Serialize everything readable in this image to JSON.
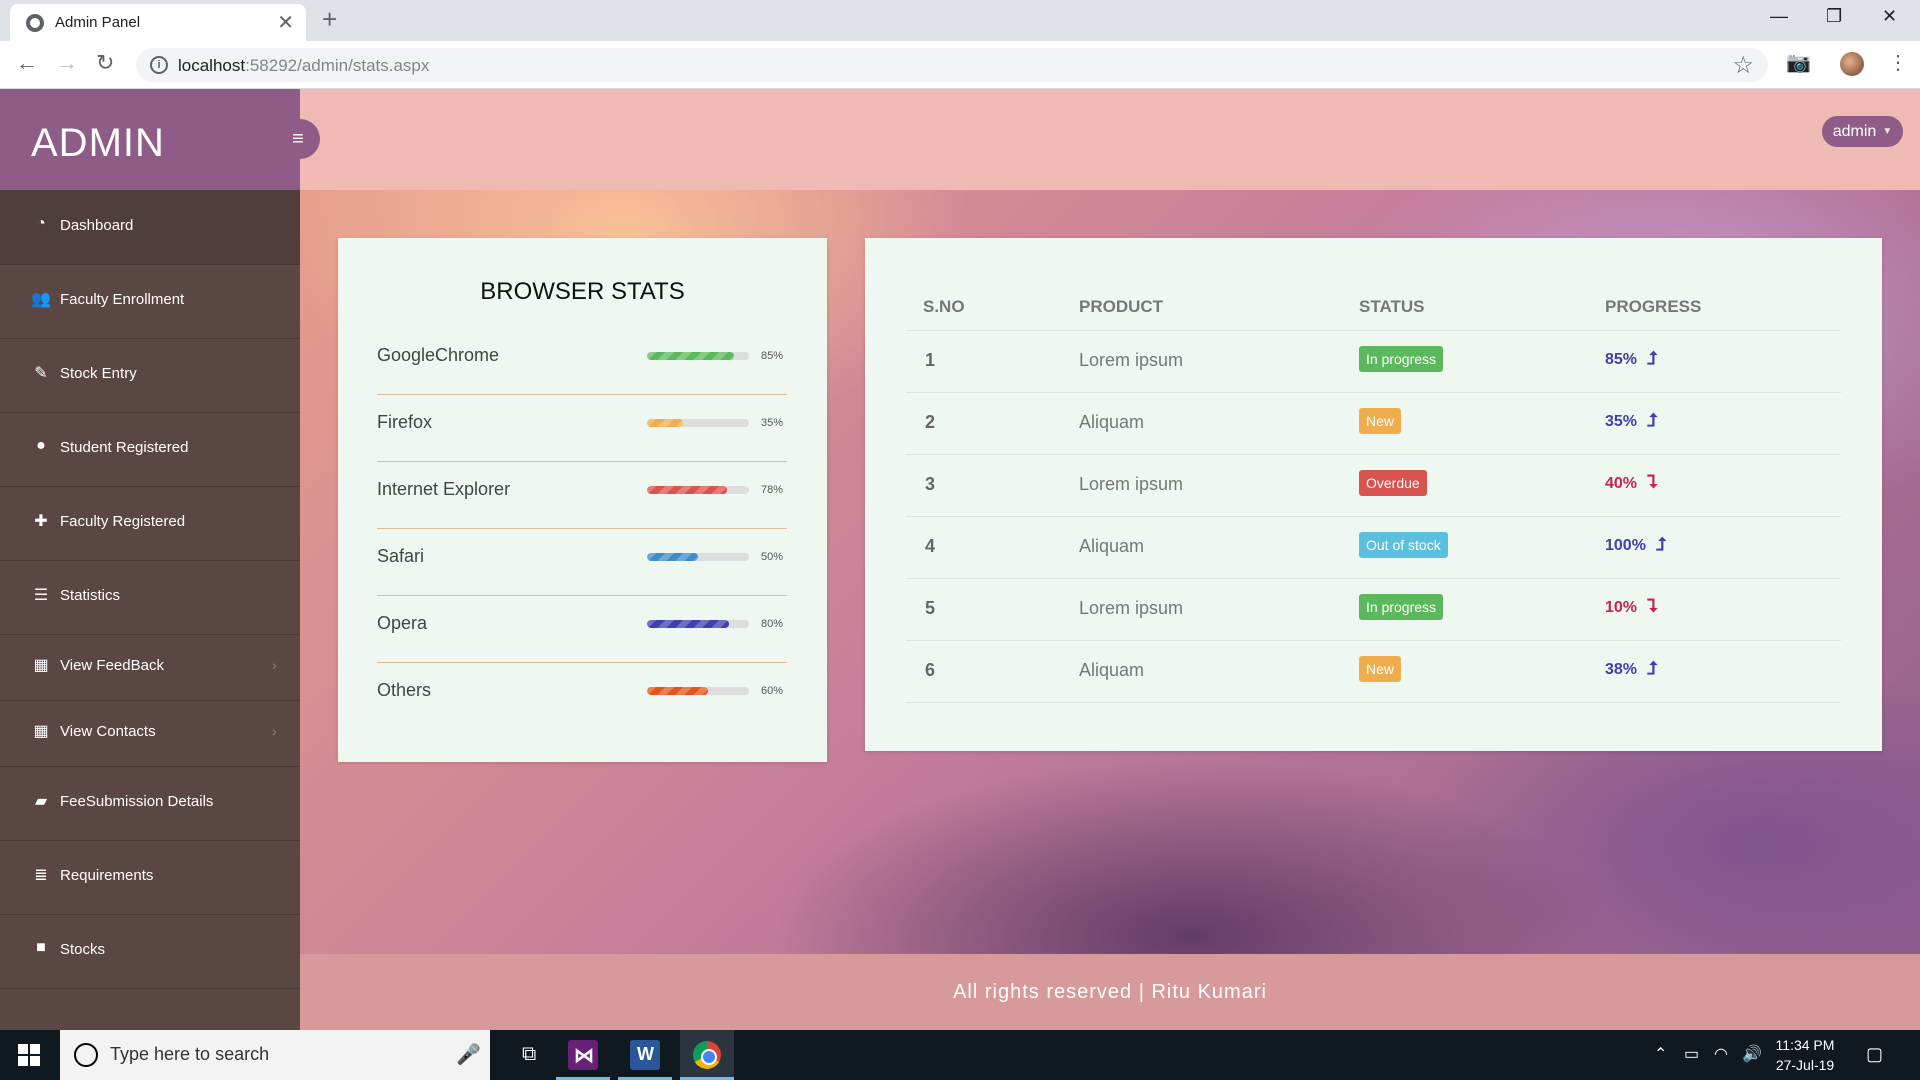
{
  "browser": {
    "tab_title": "Admin Panel",
    "url_host": "localhost",
    "url_rest": ":58292/admin/stats.aspx"
  },
  "sidebar": {
    "brand": "ADMIN",
    "items": [
      {
        "label": "Dashboard",
        "icon": "dashboard-icon"
      },
      {
        "label": "Faculty Enrollment",
        "icon": "users-icon"
      },
      {
        "label": "Stock Entry",
        "icon": "edit-icon"
      },
      {
        "label": "Student Registered",
        "icon": "user-icon"
      },
      {
        "label": "Faculty Registered",
        "icon": "user-plus-icon"
      },
      {
        "label": "Statistics",
        "icon": "list-icon"
      },
      {
        "label": "View FeedBack",
        "icon": "grid-icon"
      },
      {
        "label": "View Contacts",
        "icon": "grid-icon"
      },
      {
        "label": "FeeSubmission Details",
        "icon": "book-icon"
      },
      {
        "label": "Requirements",
        "icon": "tasks-icon"
      },
      {
        "label": "Stocks",
        "icon": "briefcase-icon"
      }
    ]
  },
  "header": {
    "user_label": "admin"
  },
  "browser_stats": {
    "title": "BROWSER STATS",
    "rows": [
      {
        "name": "GoogleChrome",
        "value": 85,
        "pct": "85%",
        "color": "#5cb85c"
      },
      {
        "name": "Firefox",
        "value": 35,
        "pct": "35%",
        "color": "#f0ad4e"
      },
      {
        "name": "Internet Explorer",
        "value": 78,
        "pct": "78%",
        "color": "#d9534f"
      },
      {
        "name": "Safari",
        "value": 50,
        "pct": "50%",
        "color": "#428bca"
      },
      {
        "name": "Opera",
        "value": 80,
        "pct": "80%",
        "color": "#3f3fad"
      },
      {
        "name": "Others",
        "value": 60,
        "pct": "60%",
        "color": "#e4541c"
      }
    ]
  },
  "products_table": {
    "headers": {
      "sno": "S.NO",
      "product": "PRODUCT",
      "status": "STATUS",
      "progress": "PROGRESS"
    },
    "rows": [
      {
        "sno": "1",
        "product": "Lorem ipsum",
        "status": "In progress",
        "status_color": "#5cb85c",
        "progress": "85%",
        "trend": "up"
      },
      {
        "sno": "2",
        "product": "Aliquam",
        "status": "New",
        "status_color": "#f0ad4e",
        "progress": "35%",
        "trend": "up"
      },
      {
        "sno": "3",
        "product": "Lorem ipsum",
        "status": "Overdue",
        "status_color": "#d9534f",
        "progress": "40%",
        "trend": "down"
      },
      {
        "sno": "4",
        "product": "Aliquam",
        "status": "Out of stock",
        "status_color": "#5bc0de",
        "progress": "100%",
        "trend": "up"
      },
      {
        "sno": "5",
        "product": "Lorem ipsum",
        "status": "In progress",
        "status_color": "#5cb85c",
        "progress": "10%",
        "trend": "down"
      },
      {
        "sno": "6",
        "product": "Aliquam",
        "status": "New",
        "status_color": "#f0ad4e",
        "progress": "38%",
        "trend": "up"
      }
    ],
    "up_color": "#3f3fad",
    "down_color": "#c7254e"
  },
  "footer": {
    "text": "All rights reserved | Ritu Kumari"
  },
  "taskbar": {
    "search_placeholder": "Type here to search",
    "time": "11:34 PM",
    "date": "27-Jul-19"
  }
}
